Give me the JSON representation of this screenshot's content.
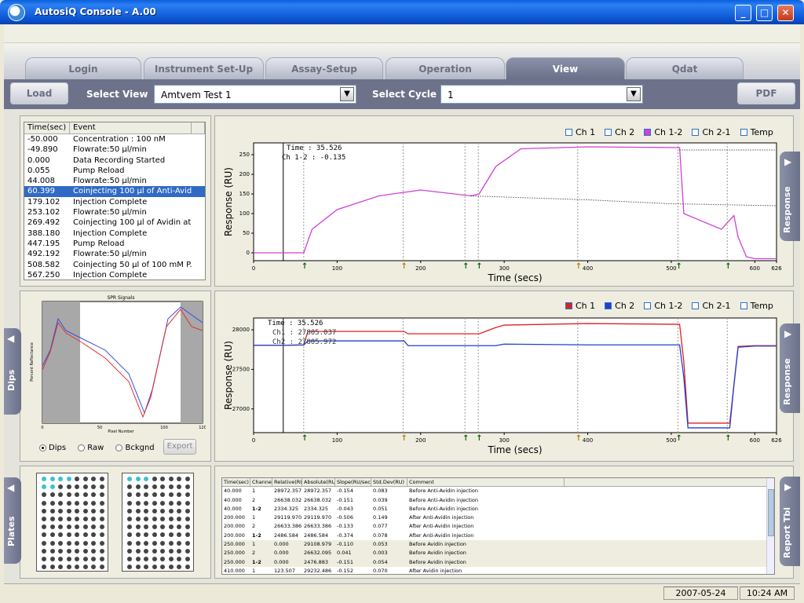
{
  "window": {
    "title": "AutosiQ Console - A.00"
  },
  "tabs": [
    {
      "label": "Login",
      "active": false
    },
    {
      "label": "Instrument Set-Up",
      "active": false
    },
    {
      "label": "Assay-Setup",
      "active": false
    },
    {
      "label": "Operation",
      "active": false
    },
    {
      "label": "View",
      "active": true
    },
    {
      "label": "Qdat",
      "active": false
    }
  ],
  "toolbar": {
    "load_label": "Load",
    "select_view_label": "Select View",
    "select_view_value": "Amtvem Test 1",
    "select_cycle_label": "Select Cycle",
    "select_cycle_value": "1",
    "pdf_label": "PDF"
  },
  "events": {
    "headers": [
      "Time(sec)",
      "Event"
    ],
    "rows": [
      [
        "-50.000",
        "Concentration : 100 nM"
      ],
      [
        "-49.890",
        "Flowrate:50 µl/min"
      ],
      [
        "0.000",
        "Data Recording Started"
      ],
      [
        "0.055",
        "Pump Reload"
      ],
      [
        "44.008",
        "Flowrate:50 µl/min"
      ],
      [
        "60.399",
        "Coinjecting 100 µl of Anti-Avid..."
      ],
      [
        "179.102",
        "Injection Complete"
      ],
      [
        "253.102",
        "Flowrate:50 µl/min"
      ],
      [
        "269.492",
        "Coinjecting 100 µl of Avidin at ..."
      ],
      [
        "388.180",
        "Injection Complete"
      ],
      [
        "447.195",
        "Pump Reload"
      ],
      [
        "492.192",
        "Flowrate:50 µl/min"
      ],
      [
        "508.582",
        "Coinjecting 50 µl of 100 mM P..."
      ],
      [
        "567.250",
        "Injection Complete"
      ]
    ],
    "selected_index": 5
  },
  "side_tabs": {
    "response_top": "Response",
    "response_bottom": "Response",
    "dips": "Dips",
    "plates": "Plates",
    "report": "Report Tbl"
  },
  "legend_top": [
    "Ch 1",
    "Ch 2",
    "Ch 1-2",
    "Ch 2-1",
    "Temp"
  ],
  "legend_bottom": [
    "Ch 1",
    "Ch 2",
    "Ch 1-2",
    "Ch 2-1",
    "Temp"
  ],
  "dips": {
    "chart_title": "SPR Signals",
    "ylabel": "Percent Reflectance",
    "xlabel": "Pixel Number",
    "options": [
      "Dips",
      "Raw",
      "Bckgnd"
    ],
    "selected": "Dips",
    "export_label": "Export"
  },
  "chart_data": [
    {
      "type": "line",
      "ylabel": "Response (RU)",
      "xlabel": "Time (secs)",
      "xlim": [
        0,
        626
      ],
      "ylim": [
        -20,
        280
      ],
      "xticks": [
        0,
        100,
        200,
        300,
        400,
        500,
        600,
        626
      ],
      "yticks": [
        0,
        50,
        100,
        150,
        200,
        250
      ],
      "cursor": {
        "time_label": "Time :",
        "time_value": "35.526",
        "ch_label": "Ch 1-2 :",
        "ch_value": "-0.135"
      },
      "series": [
        {
          "name": "Ch 1-2",
          "color": "#d040d8",
          "x": [
            0,
            35,
            60,
            70,
            100,
            150,
            200,
            260,
            270,
            290,
            320,
            400,
            510,
            515,
            560,
            575,
            580,
            590,
            600,
            626
          ],
          "y": [
            0,
            0,
            0,
            60,
            110,
            145,
            160,
            145,
            150,
            220,
            265,
            270,
            268,
            100,
            60,
            95,
            40,
            -10,
            -15,
            -15
          ]
        },
        {
          "name": "Ch 1-2 (extrapolated)",
          "color": "#000000",
          "x": [
            260,
            400,
            500,
            626
          ],
          "y": [
            145,
            135,
            125,
            120
          ]
        },
        {
          "name": "Ch 1-2 (upper)",
          "color": "#000000",
          "x": [
            510,
            626
          ],
          "y": [
            262,
            262
          ]
        }
      ],
      "markers": [
        60,
        179,
        253,
        269,
        388,
        508,
        567
      ]
    },
    {
      "type": "line",
      "ylabel": "Response (RU)",
      "xlabel": "Time (secs)",
      "xlim": [
        0,
        626
      ],
      "ylim": [
        26700,
        28150
      ],
      "xticks": [
        0,
        100,
        200,
        300,
        400,
        500,
        600,
        626
      ],
      "yticks": [
        27000,
        27500,
        28000
      ],
      "cursor": {
        "time_label": "Time :",
        "time_value": "35.526",
        "ch1_label": "Ch1 :",
        "ch1_value": "27805.037",
        "ch2_label": "Ch2 :",
        "ch2_value": "27805.972"
      },
      "series": [
        {
          "name": "Ch 1",
          "color": "#e02020",
          "x": [
            0,
            35,
            60,
            65,
            180,
            185,
            270,
            290,
            300,
            400,
            510,
            515,
            520,
            570,
            575,
            580,
            600,
            626
          ],
          "y": [
            27805,
            27805,
            27810,
            27980,
            27980,
            27950,
            27950,
            28030,
            28060,
            28080,
            28070,
            27600,
            26820,
            26820,
            27300,
            27790,
            27800,
            27800
          ]
        },
        {
          "name": "Ch 2",
          "color": "#2040d0",
          "x": [
            0,
            35,
            60,
            65,
            180,
            185,
            270,
            290,
            300,
            400,
            510,
            515,
            520,
            570,
            575,
            580,
            600,
            626
          ],
          "y": [
            27805,
            27805,
            27808,
            27860,
            27860,
            27800,
            27800,
            27800,
            27820,
            27810,
            27810,
            27400,
            26760,
            26760,
            27300,
            27780,
            27795,
            27795
          ]
        }
      ],
      "markers": [
        60,
        179,
        253,
        269,
        388,
        508,
        567
      ]
    }
  ],
  "report": {
    "headers": [
      "Time(sec)",
      "Channel",
      "Relative(RU)",
      "Absolute(RU)",
      "Slope(RU/sec)",
      "Std.Dev(RU)",
      "Comment"
    ],
    "rows": [
      [
        "40.000",
        "1",
        "28972.357",
        "28972.357",
        "-0.154",
        "0.083",
        "Before Anti-Avidin injection"
      ],
      [
        "40.000",
        "2",
        "26638.032",
        "26638.032",
        "-0.151",
        "0.039",
        "Before Anti-Avidin injection"
      ],
      [
        "40.000",
        "1-2",
        "2334.325",
        "2334.325",
        "-0.043",
        "0.051",
        "Before Anti-Avidin injection"
      ],
      [
        "200.000",
        "1",
        "29119.970",
        "29119.970",
        "-0.506",
        "0.149",
        "After Anti-Avidin injection"
      ],
      [
        "200.000",
        "2",
        "26633.386",
        "26633.386",
        "-0.133",
        "0.077",
        "After Anti-Avidin injection"
      ],
      [
        "200.000",
        "1-2",
        "2486.584",
        "2486.584",
        "-0.374",
        "0.078",
        "After Anti-Avidin injection"
      ],
      [
        "250.000",
        "1",
        "0.000",
        "29108.979",
        "-0.110",
        "0.053",
        "Before Avidin injection"
      ],
      [
        "250.000",
        "2",
        "0.000",
        "26632.095",
        "0.041",
        "0.003",
        "Before Avidin injection"
      ],
      [
        "250.000",
        "1-2",
        "0.000",
        "2476.883",
        "-0.151",
        "0.054",
        "Before Avidin injection"
      ],
      [
        "410.000",
        "1",
        "123.507",
        "29232.486",
        "-0.152",
        "0.070",
        "After Avidin injection"
      ]
    ]
  },
  "status": {
    "date": "2007-05-24",
    "time": "10:24 AM"
  }
}
